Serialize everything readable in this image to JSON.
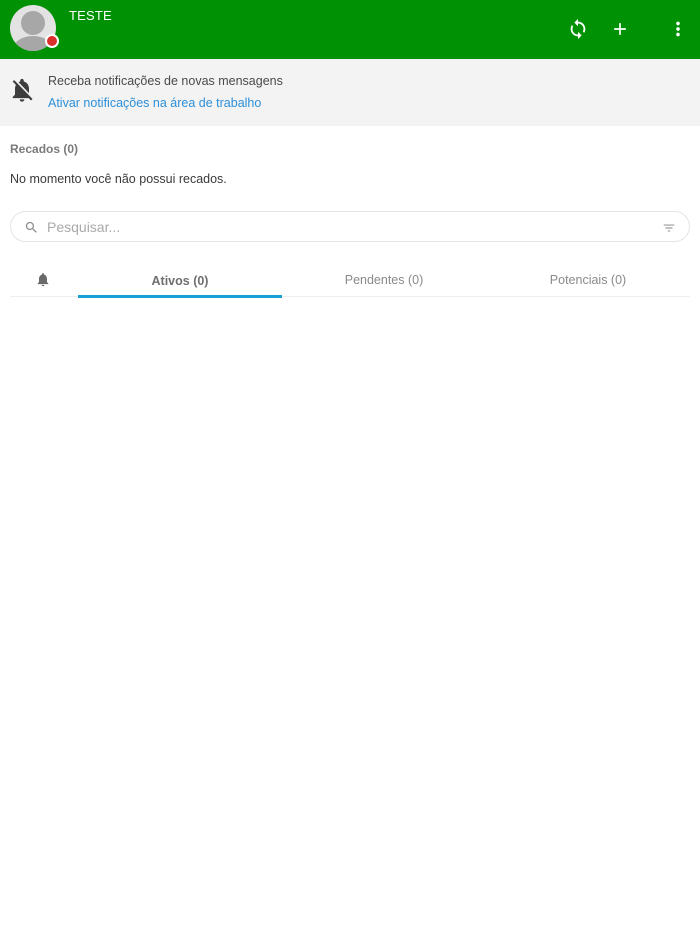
{
  "header": {
    "user_name": "TESTE",
    "status_color": "#d9302c",
    "background": "#009204",
    "actions": [
      {
        "icon": "refresh-icon"
      },
      {
        "icon": "plus-icon"
      },
      {
        "icon": "more-vert-icon"
      }
    ]
  },
  "notification": {
    "icon": "bell-off-icon",
    "title": "Receba notificações de novas mensagens",
    "link": "Ativar notificações na área de trabalho"
  },
  "recados": {
    "title": "Recados (0)",
    "empty_message": "No momento você não possui recados."
  },
  "search": {
    "placeholder": "Pesquisar...",
    "value": ""
  },
  "tabs": {
    "bell_icon": "bell-icon",
    "items": [
      {
        "label": "Ativos (0)",
        "active": true
      },
      {
        "label": "Pendentes (0)",
        "active": false
      },
      {
        "label": "Potenciais (0)",
        "active": false
      }
    ],
    "accent": "#1ba0d6"
  }
}
